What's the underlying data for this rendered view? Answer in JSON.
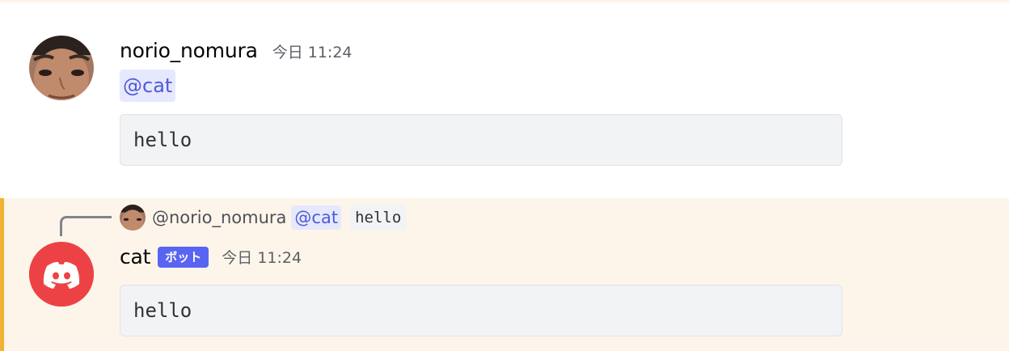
{
  "messages": [
    {
      "author": "norio_nomura",
      "timestamp": "今日 11:24",
      "mention": "@cat",
      "code": "hello"
    },
    {
      "reply": {
        "author": "@norio_nomura",
        "mention": "@cat",
        "code": "hello"
      },
      "author": "cat",
      "bot_tag": "ボット",
      "timestamp": "今日 11:24",
      "code": "hello"
    }
  ],
  "colors": {
    "mention_bg": "#e6e8fd",
    "mention_text": "#4e5bd6",
    "bot_tag": "#5865f2",
    "bot_avatar": "#ed4245",
    "highlight_bg": "#fdf5ea",
    "highlight_bar": "#f0b232"
  },
  "icons": {
    "user_avatar": "face-photo-avatar",
    "bot_avatar": "discord-logo-icon"
  }
}
